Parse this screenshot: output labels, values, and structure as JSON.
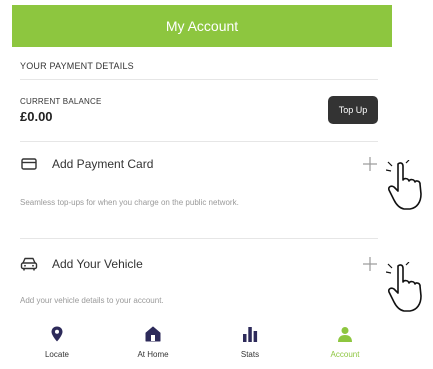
{
  "header": {
    "title": "My Account"
  },
  "payment": {
    "section_label": "YOUR PAYMENT DETAILS",
    "balance_label": "CURRENT BALANCE",
    "balance_value": "£0.00",
    "topup_label": "Top Up"
  },
  "card_row": {
    "label": "Add Payment Card",
    "helper": "Seamless top-ups for when you charge on the public network.",
    "icon": "credit-card-icon"
  },
  "vehicle_row": {
    "label": "Add Your Vehicle",
    "helper": "Add your vehicle details to your account.",
    "icon": "car-icon"
  },
  "nav": {
    "items": [
      {
        "label": "Locate",
        "icon": "location-pin-icon",
        "active": false
      },
      {
        "label": "At Home",
        "icon": "home-icon",
        "active": false
      },
      {
        "label": "Stats",
        "icon": "bar-chart-icon",
        "active": false
      },
      {
        "label": "Account",
        "icon": "user-icon",
        "active": true
      }
    ]
  },
  "colors": {
    "brand_green": "#8dc63f",
    "dark": "#333333",
    "muted": "#9a9a9a",
    "divider": "#e6e6e6"
  }
}
